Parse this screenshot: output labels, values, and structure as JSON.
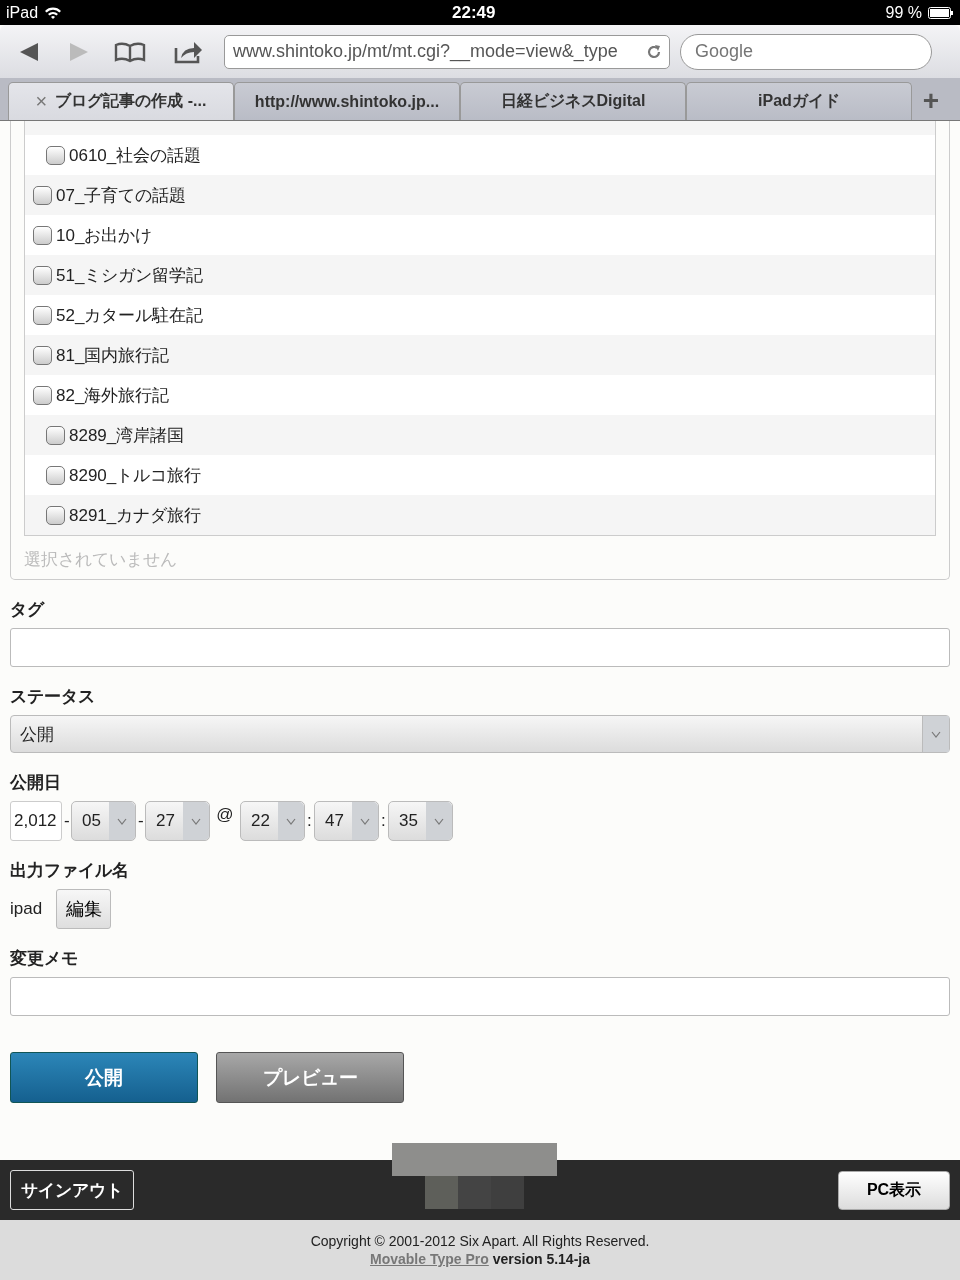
{
  "status_bar": {
    "device": "iPad",
    "time": "22:49",
    "battery": "99 %"
  },
  "toolbar": {
    "back_disabled": false,
    "forward_disabled": true,
    "url": "www.shintoko.jp/mt/mt.cgi?__mode=view&_type",
    "search": {
      "placeholder": "Google"
    }
  },
  "tabs": [
    {
      "label": "ブログ記事の作成 -...",
      "selected": true,
      "close": "×"
    },
    {
      "label": "http://www.shintoko.jp...",
      "selected": false
    },
    {
      "label": "日経ビジネスDigital",
      "selected": false
    },
    {
      "label": "iPadガイド",
      "selected": false
    }
  ],
  "new_tab": "+",
  "categories": {
    "items": [
      {
        "children": [
          {
            "label": "0610_社会の話題",
            "checked": false
          }
        ]
      },
      {
        "label": "07_子育ての話題",
        "checked": false
      },
      {
        "label": "10_お出かけ",
        "checked": false
      },
      {
        "label": "51_ミシガン留学記",
        "checked": false
      },
      {
        "label": "52_カタール駐在記",
        "checked": false
      },
      {
        "label": "81_国内旅行記",
        "checked": false
      },
      {
        "label": "82_海外旅行記",
        "checked": false,
        "children": [
          {
            "label": "8289_湾岸諸国",
            "checked": false
          },
          {
            "label": "8290_トルコ旅行",
            "checked": false
          },
          {
            "label": "8291_カナダ旅行",
            "checked": false
          }
        ]
      }
    ],
    "empty_note": "選択されていません"
  },
  "tags": {
    "label": "タグ"
  },
  "status": {
    "label": "ステータス",
    "value": "公開"
  },
  "publish_date": {
    "label": "公開日",
    "year": "2,012",
    "parts": [
      {
        "kind": "sep",
        "text": "-"
      },
      {
        "kind": "select",
        "text": "05"
      },
      {
        "kind": "sep",
        "text": "-"
      },
      {
        "kind": "select",
        "text": "27"
      },
      {
        "kind": "at",
        "text": "@"
      },
      {
        "kind": "select",
        "text": "22"
      },
      {
        "kind": "sep",
        "text": ":"
      },
      {
        "kind": "select",
        "text": "47"
      },
      {
        "kind": "sep",
        "text": ":"
      },
      {
        "kind": "select",
        "text": "35"
      }
    ]
  },
  "output_file": {
    "label": "出力ファイル名",
    "value": "ipad",
    "edit_button": "編集"
  },
  "change_memo": {
    "label": "変更メモ"
  },
  "buttons": [
    {
      "kind": "primary",
      "label": "公開"
    },
    {
      "kind": "secondary",
      "label": "プレビュー"
    }
  ],
  "footer": {
    "sign_out": "サインアウト",
    "pc_view": "PC表示",
    "copyright": "Copyright © 2001-2012 Six Apart. All Rights Reserved.",
    "product_link": "Movable Type Pro",
    "version": "version 5.14-ja"
  }
}
